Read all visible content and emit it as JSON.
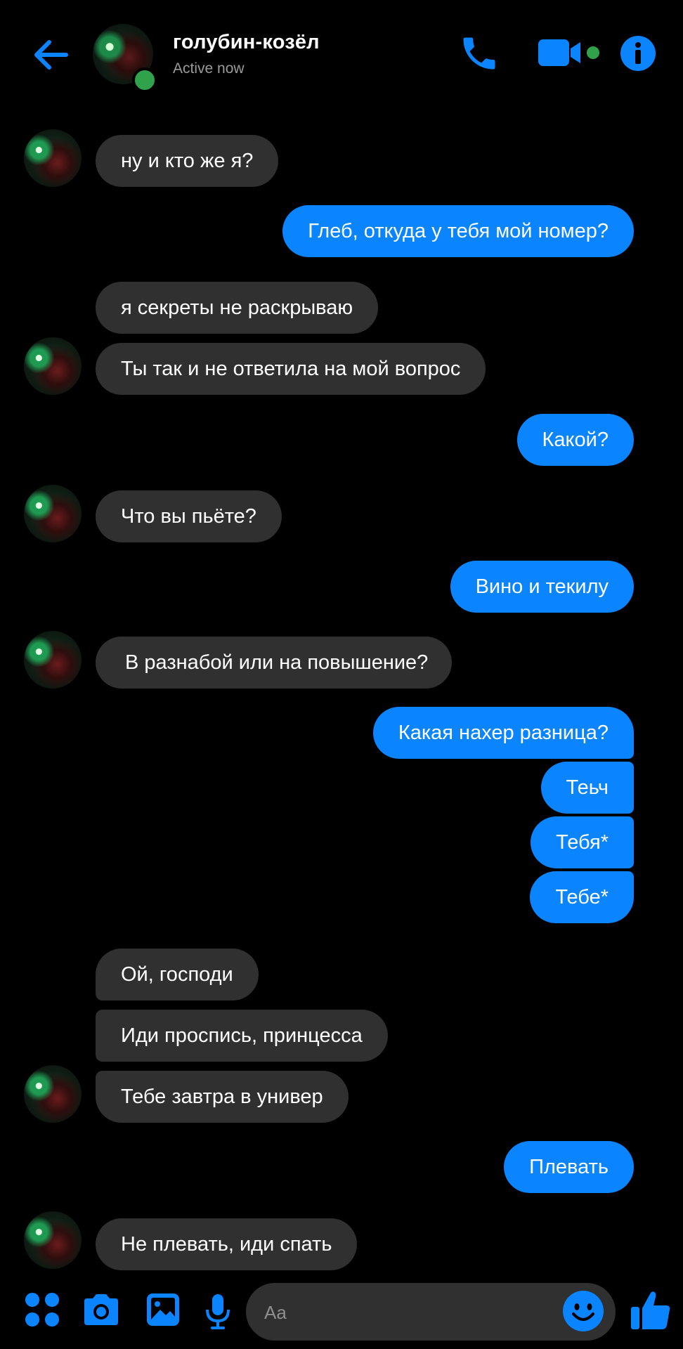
{
  "header": {
    "contact_name": "голубин-козёл",
    "status": "Active now"
  },
  "messages": [
    {
      "side": "in",
      "text": "ну и кто же я?"
    },
    {
      "side": "out",
      "text": "Глеб, откуда у тебя мой номер?"
    },
    {
      "side": "in",
      "text": "я секреты не раскрываю"
    },
    {
      "side": "in",
      "text": "Ты так и не ответила на мой вопрос"
    },
    {
      "side": "out",
      "text": "Какой?"
    },
    {
      "side": "in",
      "text": "Что вы пьёте?"
    },
    {
      "side": "out",
      "text": "Вино и текилу"
    },
    {
      "side": "in",
      "text": "В разнабой или на повышение?"
    },
    {
      "side": "out",
      "text": "Какая нахер разница?"
    },
    {
      "side": "out",
      "text": "Теьч"
    },
    {
      "side": "out",
      "text": "Тебя*"
    },
    {
      "side": "out",
      "text": "Тебе*"
    },
    {
      "side": "in",
      "text": "Ой, господи"
    },
    {
      "side": "in",
      "text": "Иди проспись,  принцесса"
    },
    {
      "side": "in",
      "text": "Тебе завтра в универ"
    },
    {
      "side": "out",
      "text": "Плевать"
    },
    {
      "side": "in",
      "text": "Не плевать, иди спать"
    }
  ],
  "composer": {
    "placeholder": "Aa"
  },
  "icons": {
    "back": "arrow-left-icon",
    "call": "phone-icon",
    "video": "video-camera-icon",
    "info": "info-icon",
    "menu": "four-dots-icon",
    "camera": "camera-icon",
    "gallery": "image-icon",
    "mic": "microphone-icon",
    "emoji": "smiley-icon",
    "like": "thumbs-up-icon"
  },
  "colors": {
    "accent": "#0a84ff",
    "incoming_bubble": "#303030",
    "background": "#000000",
    "online": "#31a24c"
  }
}
